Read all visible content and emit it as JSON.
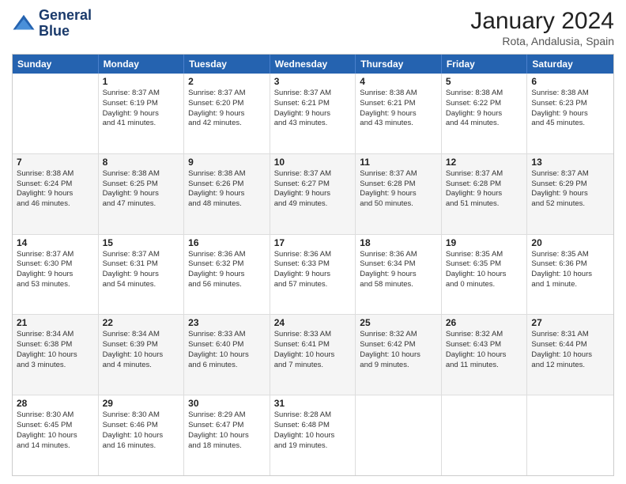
{
  "header": {
    "logo_line1": "General",
    "logo_line2": "Blue",
    "title": "January 2024",
    "subtitle": "Rota, Andalusia, Spain"
  },
  "days_of_week": [
    "Sunday",
    "Monday",
    "Tuesday",
    "Wednesday",
    "Thursday",
    "Friday",
    "Saturday"
  ],
  "weeks": [
    [
      {
        "day": "",
        "lines": []
      },
      {
        "day": "1",
        "lines": [
          "Sunrise: 8:37 AM",
          "Sunset: 6:19 PM",
          "Daylight: 9 hours",
          "and 41 minutes."
        ]
      },
      {
        "day": "2",
        "lines": [
          "Sunrise: 8:37 AM",
          "Sunset: 6:20 PM",
          "Daylight: 9 hours",
          "and 42 minutes."
        ]
      },
      {
        "day": "3",
        "lines": [
          "Sunrise: 8:37 AM",
          "Sunset: 6:21 PM",
          "Daylight: 9 hours",
          "and 43 minutes."
        ]
      },
      {
        "day": "4",
        "lines": [
          "Sunrise: 8:38 AM",
          "Sunset: 6:21 PM",
          "Daylight: 9 hours",
          "and 43 minutes."
        ]
      },
      {
        "day": "5",
        "lines": [
          "Sunrise: 8:38 AM",
          "Sunset: 6:22 PM",
          "Daylight: 9 hours",
          "and 44 minutes."
        ]
      },
      {
        "day": "6",
        "lines": [
          "Sunrise: 8:38 AM",
          "Sunset: 6:23 PM",
          "Daylight: 9 hours",
          "and 45 minutes."
        ]
      }
    ],
    [
      {
        "day": "7",
        "lines": [
          "Sunrise: 8:38 AM",
          "Sunset: 6:24 PM",
          "Daylight: 9 hours",
          "and 46 minutes."
        ]
      },
      {
        "day": "8",
        "lines": [
          "Sunrise: 8:38 AM",
          "Sunset: 6:25 PM",
          "Daylight: 9 hours",
          "and 47 minutes."
        ]
      },
      {
        "day": "9",
        "lines": [
          "Sunrise: 8:38 AM",
          "Sunset: 6:26 PM",
          "Daylight: 9 hours",
          "and 48 minutes."
        ]
      },
      {
        "day": "10",
        "lines": [
          "Sunrise: 8:37 AM",
          "Sunset: 6:27 PM",
          "Daylight: 9 hours",
          "and 49 minutes."
        ]
      },
      {
        "day": "11",
        "lines": [
          "Sunrise: 8:37 AM",
          "Sunset: 6:28 PM",
          "Daylight: 9 hours",
          "and 50 minutes."
        ]
      },
      {
        "day": "12",
        "lines": [
          "Sunrise: 8:37 AM",
          "Sunset: 6:28 PM",
          "Daylight: 9 hours",
          "and 51 minutes."
        ]
      },
      {
        "day": "13",
        "lines": [
          "Sunrise: 8:37 AM",
          "Sunset: 6:29 PM",
          "Daylight: 9 hours",
          "and 52 minutes."
        ]
      }
    ],
    [
      {
        "day": "14",
        "lines": [
          "Sunrise: 8:37 AM",
          "Sunset: 6:30 PM",
          "Daylight: 9 hours",
          "and 53 minutes."
        ]
      },
      {
        "day": "15",
        "lines": [
          "Sunrise: 8:37 AM",
          "Sunset: 6:31 PM",
          "Daylight: 9 hours",
          "and 54 minutes."
        ]
      },
      {
        "day": "16",
        "lines": [
          "Sunrise: 8:36 AM",
          "Sunset: 6:32 PM",
          "Daylight: 9 hours",
          "and 56 minutes."
        ]
      },
      {
        "day": "17",
        "lines": [
          "Sunrise: 8:36 AM",
          "Sunset: 6:33 PM",
          "Daylight: 9 hours",
          "and 57 minutes."
        ]
      },
      {
        "day": "18",
        "lines": [
          "Sunrise: 8:36 AM",
          "Sunset: 6:34 PM",
          "Daylight: 9 hours",
          "and 58 minutes."
        ]
      },
      {
        "day": "19",
        "lines": [
          "Sunrise: 8:35 AM",
          "Sunset: 6:35 PM",
          "Daylight: 10 hours",
          "and 0 minutes."
        ]
      },
      {
        "day": "20",
        "lines": [
          "Sunrise: 8:35 AM",
          "Sunset: 6:36 PM",
          "Daylight: 10 hours",
          "and 1 minute."
        ]
      }
    ],
    [
      {
        "day": "21",
        "lines": [
          "Sunrise: 8:34 AM",
          "Sunset: 6:38 PM",
          "Daylight: 10 hours",
          "and 3 minutes."
        ]
      },
      {
        "day": "22",
        "lines": [
          "Sunrise: 8:34 AM",
          "Sunset: 6:39 PM",
          "Daylight: 10 hours",
          "and 4 minutes."
        ]
      },
      {
        "day": "23",
        "lines": [
          "Sunrise: 8:33 AM",
          "Sunset: 6:40 PM",
          "Daylight: 10 hours",
          "and 6 minutes."
        ]
      },
      {
        "day": "24",
        "lines": [
          "Sunrise: 8:33 AM",
          "Sunset: 6:41 PM",
          "Daylight: 10 hours",
          "and 7 minutes."
        ]
      },
      {
        "day": "25",
        "lines": [
          "Sunrise: 8:32 AM",
          "Sunset: 6:42 PM",
          "Daylight: 10 hours",
          "and 9 minutes."
        ]
      },
      {
        "day": "26",
        "lines": [
          "Sunrise: 8:32 AM",
          "Sunset: 6:43 PM",
          "Daylight: 10 hours",
          "and 11 minutes."
        ]
      },
      {
        "day": "27",
        "lines": [
          "Sunrise: 8:31 AM",
          "Sunset: 6:44 PM",
          "Daylight: 10 hours",
          "and 12 minutes."
        ]
      }
    ],
    [
      {
        "day": "28",
        "lines": [
          "Sunrise: 8:30 AM",
          "Sunset: 6:45 PM",
          "Daylight: 10 hours",
          "and 14 minutes."
        ]
      },
      {
        "day": "29",
        "lines": [
          "Sunrise: 8:30 AM",
          "Sunset: 6:46 PM",
          "Daylight: 10 hours",
          "and 16 minutes."
        ]
      },
      {
        "day": "30",
        "lines": [
          "Sunrise: 8:29 AM",
          "Sunset: 6:47 PM",
          "Daylight: 10 hours",
          "and 18 minutes."
        ]
      },
      {
        "day": "31",
        "lines": [
          "Sunrise: 8:28 AM",
          "Sunset: 6:48 PM",
          "Daylight: 10 hours",
          "and 19 minutes."
        ]
      },
      {
        "day": "",
        "lines": []
      },
      {
        "day": "",
        "lines": []
      },
      {
        "day": "",
        "lines": []
      }
    ]
  ]
}
